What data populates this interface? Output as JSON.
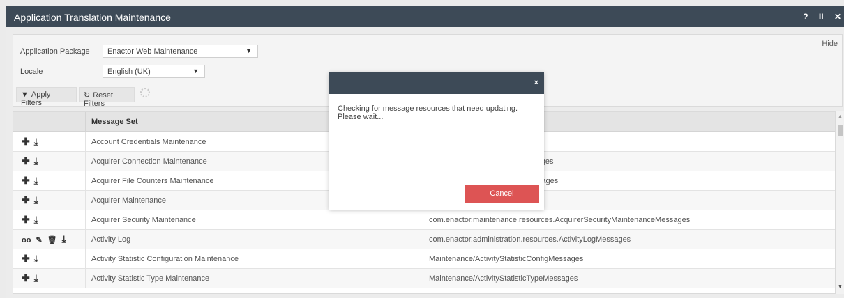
{
  "window": {
    "title": "Application Translation Maintenance",
    "controls": [
      "?",
      "II",
      "✕"
    ]
  },
  "filters": {
    "hide_label": "Hide",
    "package_label": "Application Package",
    "package_value": "Enactor Web Maintenance",
    "locale_label": "Locale",
    "locale_value": "English (UK)",
    "apply_label": "Apply Filters",
    "reset_label": "Reset Filters"
  },
  "grid": {
    "columns": [
      "",
      "Message Set",
      ""
    ],
    "rows": [
      {
        "actions": "add",
        "set": "Account Credentials Maintenance",
        "resource": ""
      },
      {
        "actions": "add",
        "set": "Acquirer Connection Maintenance",
        "resource": "erConnectionMaintenanceMessages"
      },
      {
        "actions": "add",
        "set": "Acquirer File Counters Maintenance",
        "resource": "erFileCountersMaintenanceMessages"
      },
      {
        "actions": "add",
        "set": "Acquirer Maintenance",
        "resource": "erMaintenanceMessages"
      },
      {
        "actions": "add",
        "set": "Acquirer Security Maintenance",
        "resource": "com.enactor.maintenance.resources.AcquirerSecurityMaintenanceMessages"
      },
      {
        "actions": "edit",
        "set": "Activity Log",
        "resource": "com.enactor.administration.resources.ActivityLogMessages"
      },
      {
        "actions": "add",
        "set": "Activity Statistic Configuration Maintenance",
        "resource": "Maintenance/ActivityStatisticConfigMessages"
      },
      {
        "actions": "add",
        "set": "Activity Statistic Type Maintenance",
        "resource": "Maintenance/ActivityStatisticTypeMessages"
      }
    ]
  },
  "modal": {
    "close": "×",
    "message": "Checking for message resources that need updating. Please wait...",
    "cancel_label": "Cancel"
  },
  "colors": {
    "titlebar": "#3d4a57",
    "cancel": "#dd5454"
  },
  "icons": {
    "add": "plus-icon",
    "download": "download-icon",
    "view": "binoculars-icon",
    "edit": "pencil-icon",
    "delete": "trash-icon",
    "filter": "filter-icon",
    "reset": "reset-icon"
  }
}
